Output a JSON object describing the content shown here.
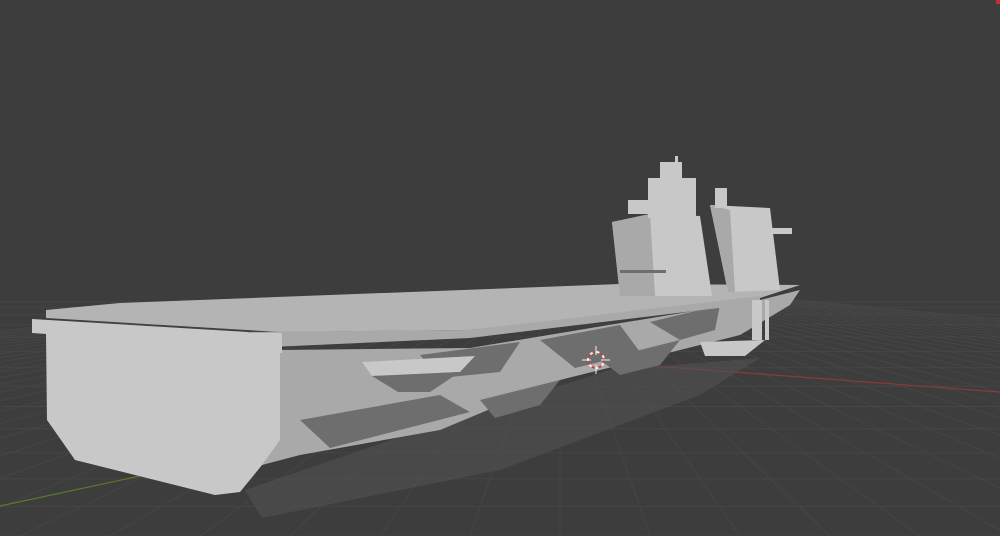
{
  "viewport": {
    "background": "#3d3d3d",
    "grid_color": "#474747",
    "axis_x_color": "#8a3a3a",
    "axis_y_color": "#5a7a2a",
    "corner_tick_color": "#c03030"
  },
  "model": {
    "hull_light": "#c8c8c8",
    "hull_mid": "#a9a9a9",
    "hull_shadow": "#6e6e6e",
    "deck_top": "#b4b4b4",
    "underside": "#545454"
  },
  "cursor": {
    "ring_color_a": "#d23c3c",
    "ring_color_b": "#f0f0f0"
  },
  "icons": {
    "3d_cursor": "3d-cursor-icon"
  }
}
